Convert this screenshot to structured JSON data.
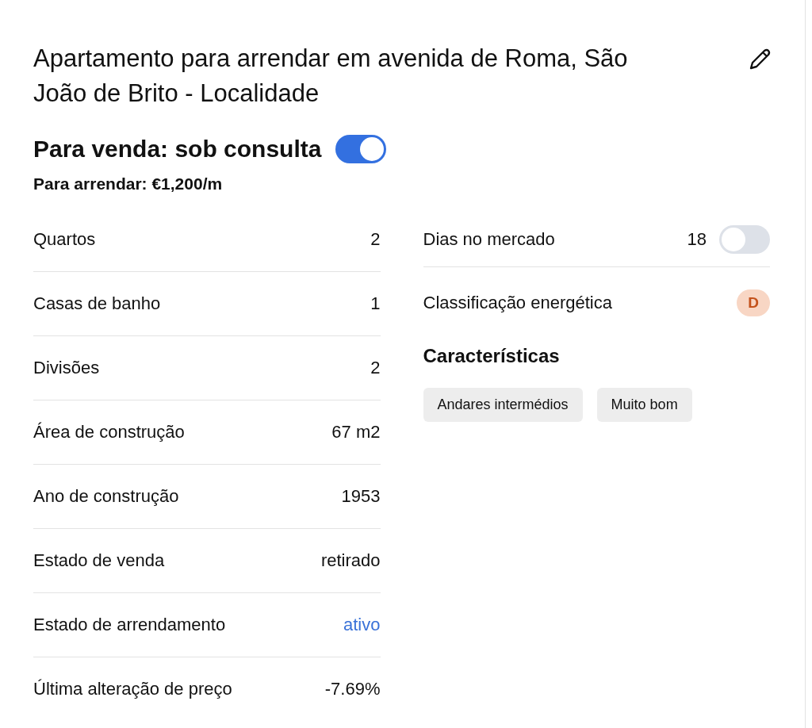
{
  "title": "Apartamento para arrendar em avenida de Roma, São João de Brito - Localidade",
  "sale": {
    "label": "Para venda: sob consulta",
    "on": true
  },
  "rent": "Para arrendar: €1,200/m",
  "details": [
    {
      "label": "Quartos",
      "value": "2",
      "kind": "text"
    },
    {
      "label": "Casas de banho",
      "value": "1",
      "kind": "text"
    },
    {
      "label": "Divisões",
      "value": "2",
      "kind": "text"
    },
    {
      "label": "Área de construção",
      "value": "67 m2",
      "kind": "text"
    },
    {
      "label": "Ano de construção",
      "value": "1953",
      "kind": "text"
    },
    {
      "label": "Estado de venda",
      "value": "retirado",
      "kind": "text"
    },
    {
      "label": "Estado de arrendamento",
      "value": "ativo",
      "kind": "link"
    },
    {
      "label": "Última alteração de preço",
      "value": "-7.69%",
      "kind": "text"
    }
  ],
  "side": [
    {
      "kind": "toggle",
      "label": "Dias no mercado",
      "value": "18",
      "on": false
    },
    {
      "kind": "badge",
      "label": "Classificação energética",
      "value": "D"
    }
  ],
  "features": {
    "heading": "Características",
    "tags": [
      "Andares intermédios",
      "Muito bom"
    ]
  }
}
